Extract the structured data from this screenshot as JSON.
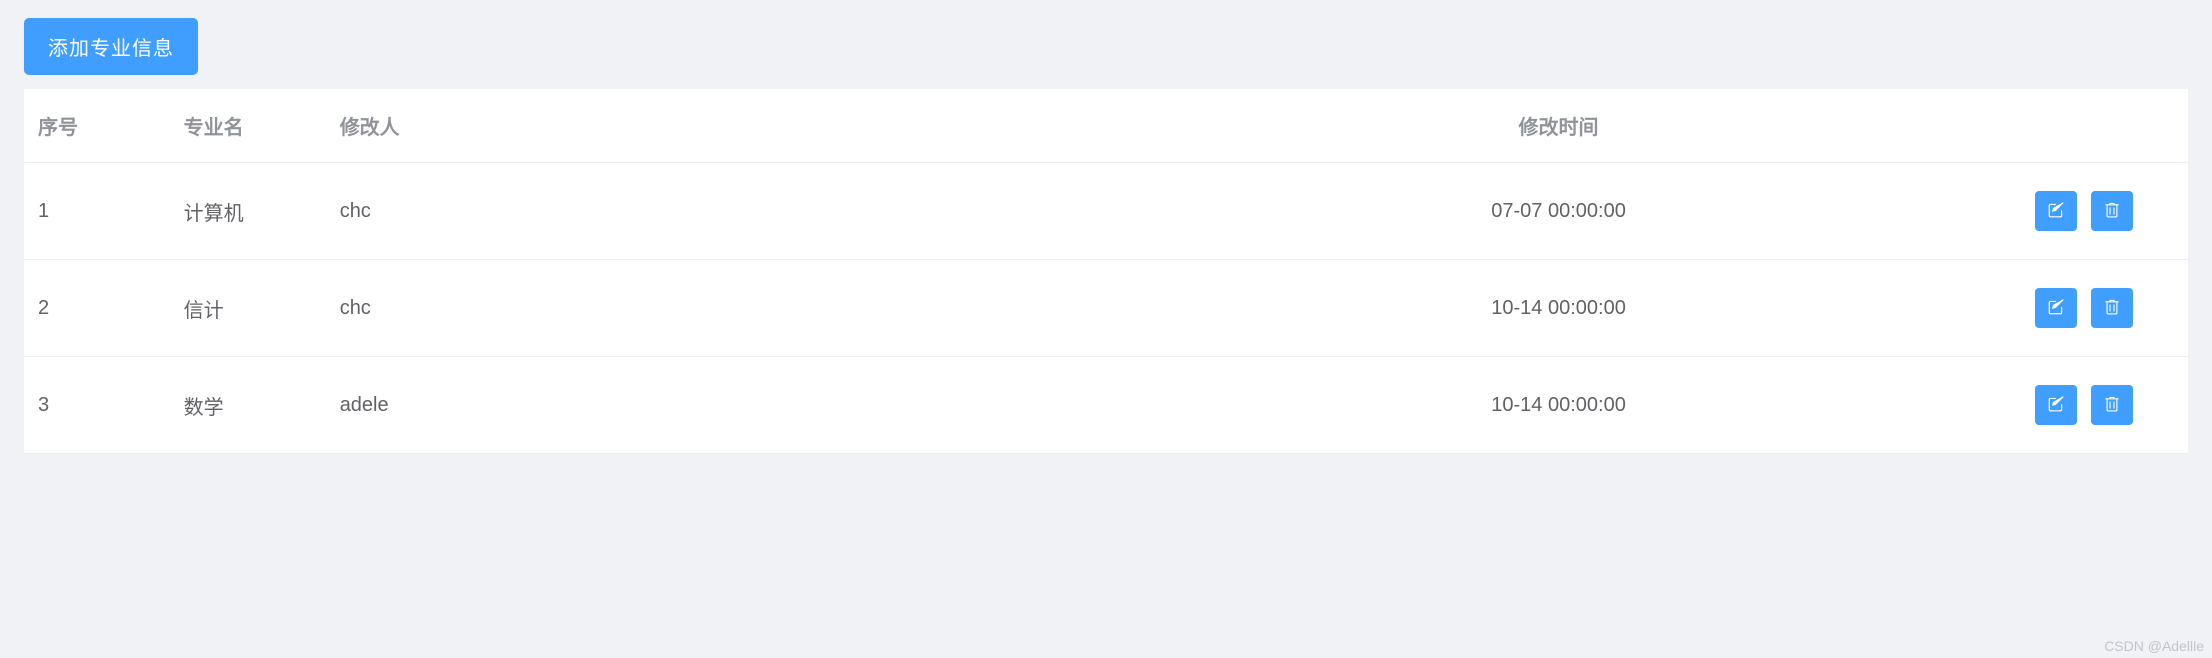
{
  "toolbar": {
    "add_label": "添加专业信息"
  },
  "columns": {
    "index": "序号",
    "name": "专业名",
    "modifier": "修改人",
    "modify_time": "修改时间",
    "ops": ""
  },
  "rows": [
    {
      "index": "1",
      "name": "计算机",
      "modifier": "chc",
      "modify_time": "07-07 00:00:00"
    },
    {
      "index": "2",
      "name": "信计",
      "modifier": "chc",
      "modify_time": "10-14 00:00:00"
    },
    {
      "index": "3",
      "name": "数学",
      "modifier": "adele",
      "modify_time": "10-14 00:00:00"
    }
  ],
  "icons": {
    "edit": "edit-icon",
    "delete": "delete-icon"
  },
  "colors": {
    "primary": "#409eff",
    "header_text": "#909399",
    "body_text": "#606266",
    "border": "#ebeef5",
    "page_bg": "#f0f2f5"
  },
  "watermark": "CSDN @Adellle"
}
